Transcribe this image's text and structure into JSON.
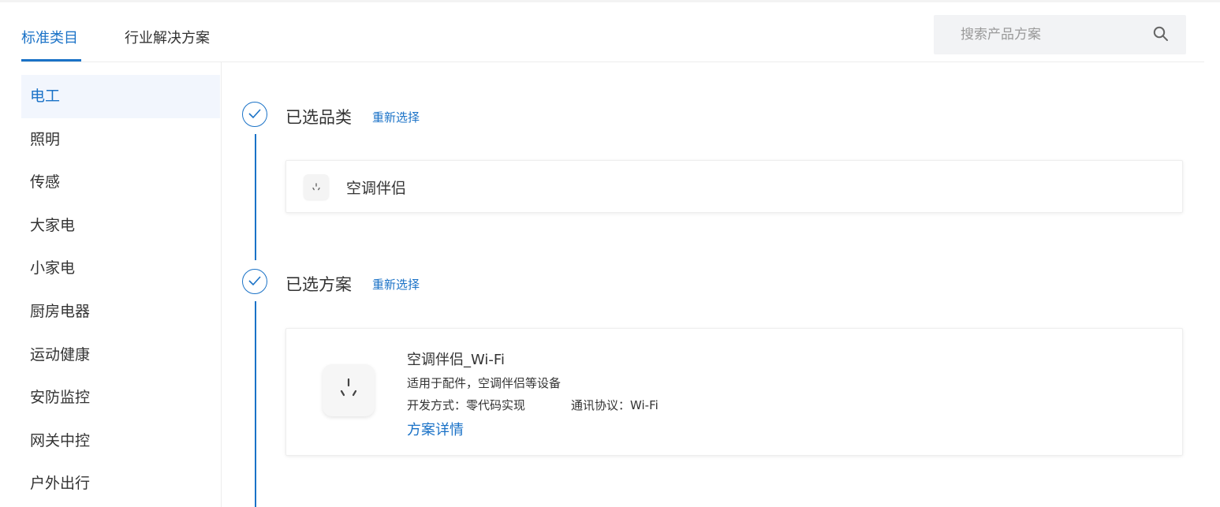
{
  "tabs": [
    {
      "label": "标准类目",
      "active": true
    },
    {
      "label": "行业解决方案",
      "active": false
    }
  ],
  "search": {
    "placeholder": "搜索产品方案",
    "value": ""
  },
  "sidebar": {
    "items": [
      {
        "label": "电工",
        "active": true
      },
      {
        "label": "照明",
        "active": false
      },
      {
        "label": "传感",
        "active": false
      },
      {
        "label": "大家电",
        "active": false
      },
      {
        "label": "小家电",
        "active": false
      },
      {
        "label": "厨房电器",
        "active": false
      },
      {
        "label": "运动健康",
        "active": false
      },
      {
        "label": "安防监控",
        "active": false
      },
      {
        "label": "网关中控",
        "active": false
      },
      {
        "label": "户外出行",
        "active": false
      }
    ]
  },
  "steps": {
    "category": {
      "title": "已选品类",
      "reselect_label": "重新选择",
      "selected_name": "空调伴侣",
      "icon": "socket-icon"
    },
    "solution": {
      "title": "已选方案",
      "reselect_label": "重新选择",
      "name": "空调伴侣_Wi-Fi",
      "description": "适用于配件，空调伴侣等设备",
      "dev_method": "开发方式：零代码实现",
      "protocol": "通讯协议：Wi-Fi",
      "detail_link": "方案详情",
      "icon": "socket-icon"
    }
  },
  "colors": {
    "accent": "#1a72c7",
    "active_bg": "#f2f6fd",
    "search_bg": "#f2f3f5"
  }
}
